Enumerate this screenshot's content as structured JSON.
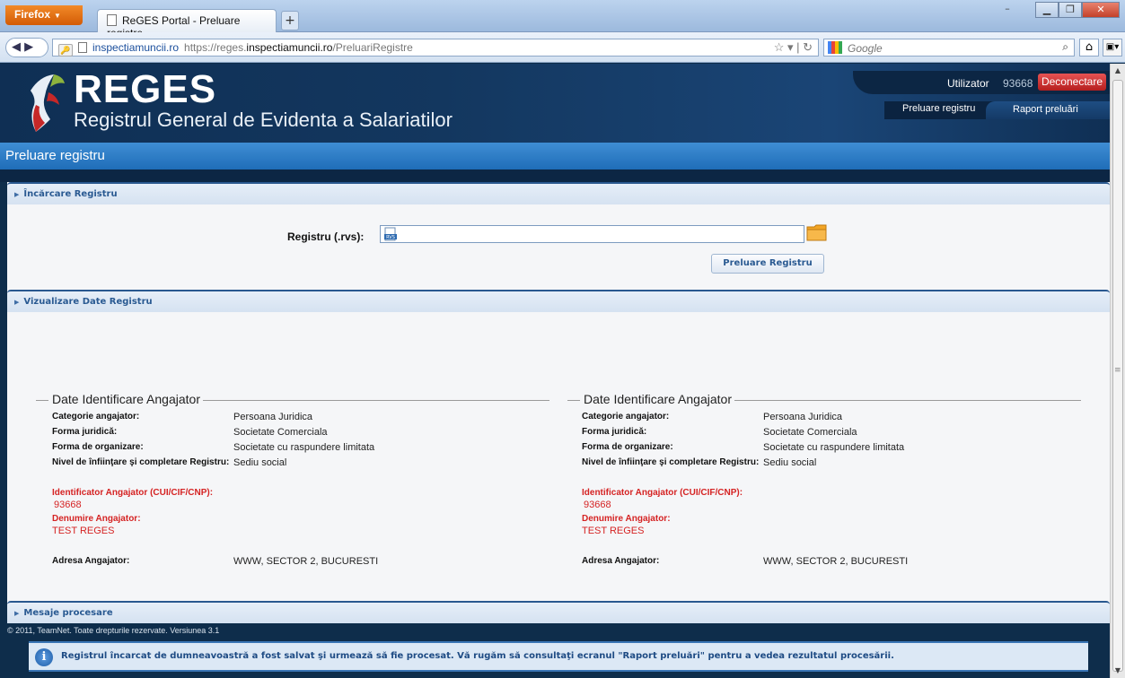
{
  "browser": {
    "app_button": "Firefox",
    "tab_title": "ReGES Portal - Preluare registre",
    "new_tab": "+",
    "site_identity": "inspectiamuncii.ro",
    "url_proto": "https://reges.",
    "url_domain": "inspectiamuncii.ro",
    "url_path": "/PreluariRegistre",
    "search_placeholder": "Google"
  },
  "header": {
    "logo": "REGES",
    "subtitle": "Registrul General de Evidenta a Salariatilor",
    "user_label": "Utilizator",
    "user_id": "93668",
    "logout": "Deconectare",
    "nav": [
      "Preluare registru",
      "Raport preluări"
    ]
  },
  "page_title": "Preluare registru",
  "sections": {
    "upload": "Încărcare Registru",
    "view": "Vizualizare Date Registru",
    "messages": "Mesaje procesare"
  },
  "upload": {
    "label": "Registru (.rvs):",
    "submit": "Preluare Registru"
  },
  "employer_blocks": [
    {
      "title": "Date Identificare Angajator",
      "rows": [
        {
          "k": "Categorie angajator:",
          "v": "Persoana Juridica"
        },
        {
          "k": "Forma juridică:",
          "v": "Societate Comerciala"
        },
        {
          "k": "Forma de organizare:",
          "v": "Societate cu raspundere limitata"
        },
        {
          "k": "Nivel de înfiinţare şi completare Registru:",
          "v": "Sediu social"
        }
      ],
      "id_label": "Identificator Angajator (CUI/CIF/CNP):",
      "id_value": "93668",
      "name_label": "Denumire Angajator:",
      "name_value": "TEST REGES",
      "address_label": "Adresa Angajator:",
      "address_value": "WWW, SECTOR 2, BUCURESTI"
    },
    {
      "title": "Date Identificare Angajator",
      "rows": [
        {
          "k": "Categorie angajator:",
          "v": "Persoana Juridica"
        },
        {
          "k": "Forma juridică:",
          "v": "Societate Comerciala"
        },
        {
          "k": "Forma de organizare:",
          "v": "Societate cu raspundere limitata"
        },
        {
          "k": "Nivel de înfiinţare şi completare Registru:",
          "v": "Sediu social"
        }
      ],
      "id_label": "Identificator Angajator (CUI/CIF/CNP):",
      "id_value": "93668",
      "name_label": "Denumire Angajator:",
      "name_value": "TEST REGES",
      "address_label": "Adresa Angajator:",
      "address_value": "WWW, SECTOR 2, BUCURESTI"
    }
  ],
  "message": "Registrul încarcat de dumneavoastră a fost salvat şi urmează să fie procesat. Vă rugăm să consultaţi ecranul \"Raport preluări\" pentru a vedea rezultatul procesării.",
  "footer": "© 2011, TeamNet. Toate drepturile rezervate. Versiunea 3.1",
  "colors": {
    "accent": "#1f6db8",
    "header_bg": "#0e2d4b",
    "logout": "#c62828",
    "error_red": "#d52323"
  }
}
